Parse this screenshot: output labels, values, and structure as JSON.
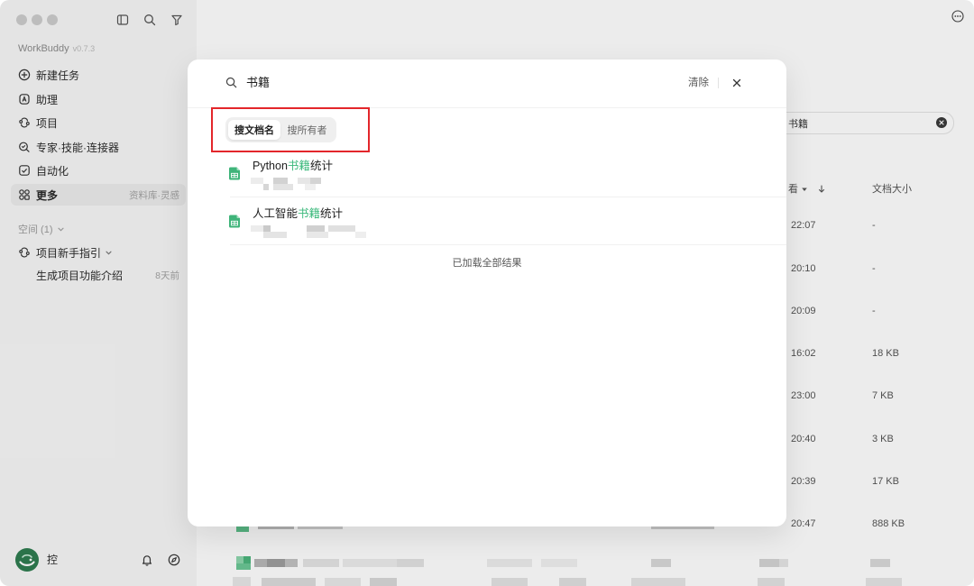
{
  "app": {
    "name": "WorkBuddy",
    "version": "v0.7.3"
  },
  "sidebar": {
    "items": [
      {
        "label": "新建任务",
        "icon": "plus-circle-icon"
      },
      {
        "label": "助理",
        "icon": "assistant-icon"
      },
      {
        "label": "项目",
        "icon": "project-icon"
      },
      {
        "label": "专家·技能·连接器",
        "icon": "expert-icon"
      },
      {
        "label": "自动化",
        "icon": "automation-icon"
      },
      {
        "label": "更多",
        "icon": "grid-icon",
        "hint": "资料库·灵感",
        "active": true
      }
    ],
    "space_header": "空间 (1)",
    "project": {
      "label": "项目新手指引",
      "icon": "project-icon"
    },
    "task": {
      "label": "生成项目功能介绍",
      "time": "8天前"
    },
    "user": {
      "name": "控"
    }
  },
  "main": {
    "filter_value": "书籍",
    "table": {
      "columns": [
        {
          "label": "看",
          "icon": "caret-down-icon",
          "sort_icon": "sort-down-icon"
        },
        {
          "label": "文档大小"
        }
      ],
      "rows": [
        {
          "time": "22:07",
          "size": "-"
        },
        {
          "time": "20:10",
          "size": "-"
        },
        {
          "time": "20:09",
          "size": "-"
        },
        {
          "time": "16:02",
          "size": "18 KB"
        },
        {
          "time": "23:00",
          "size": "7 KB"
        },
        {
          "time": "20:40",
          "size": "3 KB"
        },
        {
          "time": "20:39",
          "size": "17 KB"
        },
        {
          "time": "20:47",
          "size": "888 KB"
        }
      ]
    }
  },
  "search_dialog": {
    "query": "书籍",
    "clear_label": "清除",
    "tabs": [
      {
        "label": "搜文档名",
        "active": true
      },
      {
        "label": "搜所有者",
        "active": false
      }
    ],
    "results": [
      {
        "prefix": "Python",
        "match": "书籍",
        "suffix": "统计",
        "icon": "sheet-icon"
      },
      {
        "prefix": "人工智能",
        "match": "书籍",
        "suffix": "统计",
        "icon": "sheet-icon"
      }
    ],
    "footer": "已加载全部结果"
  },
  "colors": {
    "match_highlight": "#3cb97c",
    "sheet_icon": "#3fb47a",
    "annotation_box": "#e3262b",
    "avatar": "#2f7d50"
  }
}
